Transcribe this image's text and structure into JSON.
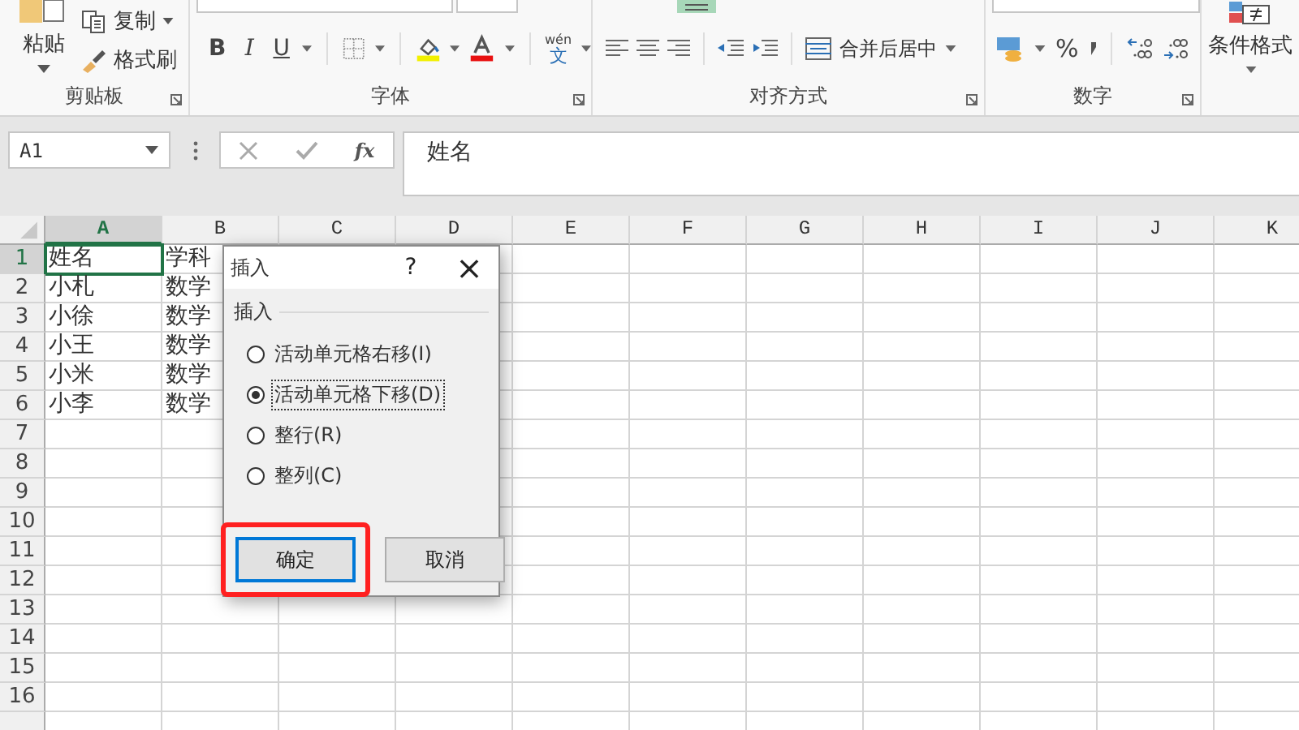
{
  "ribbon": {
    "groups": [
      {
        "kind": "clipboard",
        "label": "剪贴板",
        "paste": "粘贴",
        "items": [
          "复制",
          "格式刷"
        ]
      },
      {
        "kind": "font",
        "label": "字体",
        "bold": "B",
        "italic": "I",
        "underline": "U",
        "phonetic_top": "wén",
        "phonetic_bottom": "文"
      },
      {
        "kind": "alignment",
        "label": "对齐方式",
        "merge": "合并后居中"
      },
      {
        "kind": "number",
        "label": "数字",
        "percent": "%"
      },
      {
        "kind": "styles",
        "label": "条件格式"
      }
    ]
  },
  "formula_bar": {
    "name_box": "A1",
    "fx": "fx",
    "formula": "姓名"
  },
  "sheet": {
    "columns": [
      {
        "label": "A",
        "selected": true
      },
      {
        "label": "B",
        "selected": false
      },
      {
        "label": "C",
        "selected": false
      },
      {
        "label": "D",
        "selected": false
      },
      {
        "label": "E",
        "selected": false
      },
      {
        "label": "F",
        "selected": false
      },
      {
        "label": "G",
        "selected": false
      },
      {
        "label": "H",
        "selected": false
      },
      {
        "label": "I",
        "selected": false
      },
      {
        "label": "J",
        "selected": false
      },
      {
        "label": "K",
        "selected": false
      }
    ],
    "rows": [
      {
        "label": "1",
        "selected": true,
        "cells": [
          "姓名",
          "学科"
        ]
      },
      {
        "label": "2",
        "selected": false,
        "cells": [
          "小札",
          "数学"
        ]
      },
      {
        "label": "3",
        "selected": false,
        "cells": [
          "小徐",
          "数学"
        ]
      },
      {
        "label": "4",
        "selected": false,
        "cells": [
          "小王",
          "数学"
        ]
      },
      {
        "label": "5",
        "selected": false,
        "cells": [
          "小米",
          "数学"
        ]
      },
      {
        "label": "6",
        "selected": false,
        "cells": [
          "小李",
          "数学"
        ]
      },
      {
        "label": "7",
        "selected": false,
        "cells": []
      },
      {
        "label": "8",
        "selected": false,
        "cells": []
      },
      {
        "label": "9",
        "selected": false,
        "cells": []
      },
      {
        "label": "10",
        "selected": false,
        "cells": []
      },
      {
        "label": "11",
        "selected": false,
        "cells": []
      },
      {
        "label": "12",
        "selected": false,
        "cells": []
      },
      {
        "label": "13",
        "selected": false,
        "cells": []
      },
      {
        "label": "14",
        "selected": false,
        "cells": []
      },
      {
        "label": "15",
        "selected": false,
        "cells": []
      },
      {
        "label": "16",
        "selected": false,
        "cells": []
      }
    ]
  },
  "dialog": {
    "title": "插入",
    "help": "?",
    "close": "×",
    "group": "插入",
    "options": [
      {
        "label": "活动单元格右移(I)",
        "selected": false
      },
      {
        "label": "活动单元格下移(D)",
        "selected": true
      },
      {
        "label": "整行(R)",
        "selected": false
      },
      {
        "label": "整列(C)",
        "selected": false
      }
    ],
    "buttons": [
      {
        "label": "确定",
        "default": true,
        "highlighted": true
      },
      {
        "label": "取消",
        "default": false,
        "highlighted": false
      }
    ]
  }
}
